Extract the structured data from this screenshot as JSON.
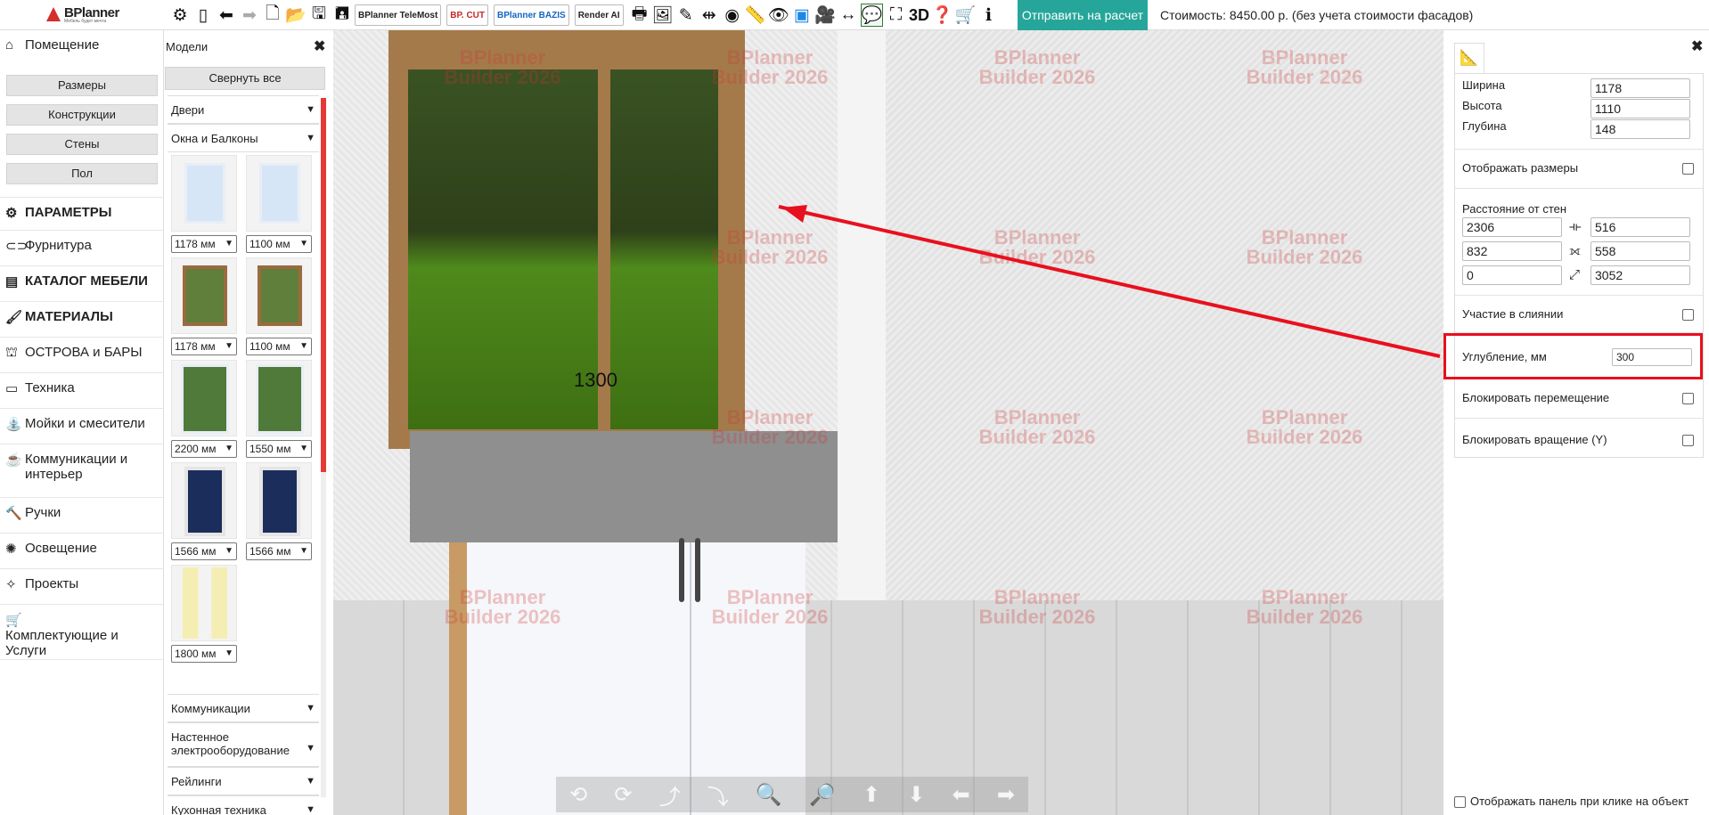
{
  "topbar": {
    "logo_name": "BPlanner",
    "logo_tag": "Мебель будет мечта",
    "brand_telemost": "BPlanner TeleMost",
    "brand_cut": "BP. CUT",
    "brand_bazis": "BPlanner BAZIS",
    "brand_render": "Render AI",
    "label_3d": "3D",
    "send_button": "Отправить на расчет",
    "cost": "Стоимость: 8450.00 р. (без учета стоимости фасадов)"
  },
  "leftnav": {
    "room": "Помещение",
    "room_sub": [
      "Размеры",
      "Конструкции",
      "Стены",
      "Пол"
    ],
    "params": "ПАРАМЕТРЫ",
    "hardware": "Фурнитура",
    "catalog": "КАТАЛОГ МЕБЕЛИ",
    "materials": "МАТЕРИАЛЫ",
    "islands": "ОСТРОВА и БАРЫ",
    "appliances": "Техника",
    "sinks": "Мойки и смесители",
    "communications": "Коммуникации и интерьер",
    "handles": "Ручки",
    "lighting": "Освещение",
    "projects": "Проекты",
    "services": "Комплектующие и Услуги"
  },
  "models": {
    "title": "Модели",
    "collapse_all": "Свернуть все",
    "doors": "Двери",
    "windows": "Окна и Балконы",
    "items": [
      "1178 мм",
      "1100 мм",
      "1178 мм",
      "1100 мм",
      "2200 мм",
      "1550 мм",
      "1566 мм",
      "1566 мм",
      "1800 мм"
    ],
    "communications": "Коммуникации",
    "wall_electric": "Настенное электрооборудование",
    "rails": "Рейлинги",
    "kitchen_appliances": "Кухонная техника"
  },
  "viewport": {
    "window_label": "1300",
    "watermark_line1": "BPlanner",
    "watermark_line2": "Builder 2026"
  },
  "properties": {
    "width_label": "Ширина",
    "width_value": "1178",
    "height_label": "Высота",
    "height_value": "1110",
    "depth_label": "Глубина",
    "depth_value": "148",
    "show_dims": "Отображать размеры",
    "dist_label": "Расстояние от стен",
    "dist_x1": "2306",
    "dist_x2": "516",
    "dist_y1": "832",
    "dist_y2": "558",
    "dist_z1": "0",
    "dist_z2": "3052",
    "merge": "Участие в слиянии",
    "recess_label": "Углубление, мм",
    "recess_value": "300",
    "lock_move": "Блокировать перемещение",
    "lock_rotate": "Блокировать вращение (Y)",
    "show_panel_on_click": "Отображать панель при клике на объект"
  }
}
